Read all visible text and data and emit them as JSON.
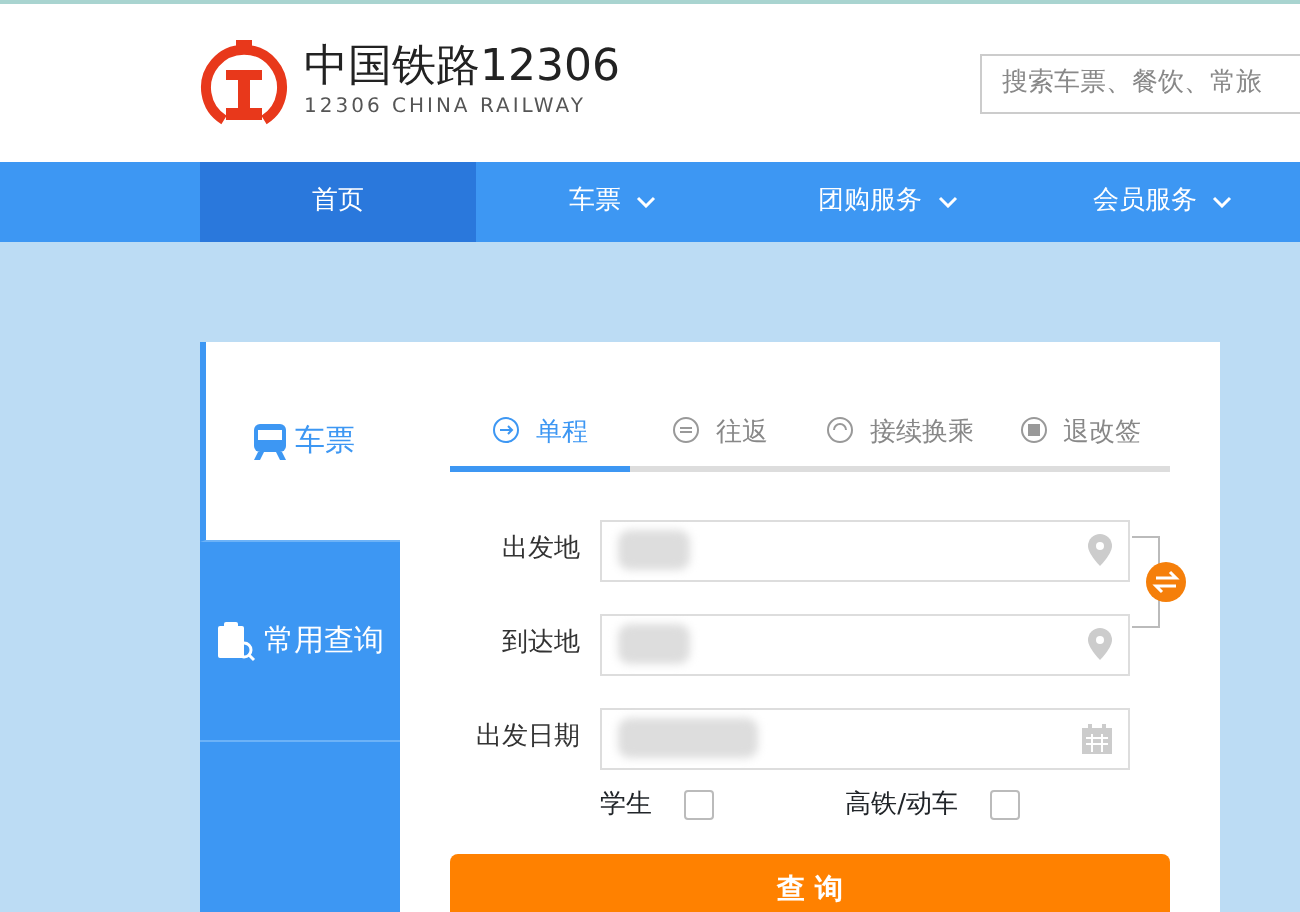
{
  "header": {
    "logo_title": "中国铁路12306",
    "logo_subtitle": "12306 CHINA RAILWAY",
    "search": {
      "placeholder": "搜索车票、餐饮、常旅"
    }
  },
  "nav": [
    {
      "label": "首页",
      "selected": true,
      "dropdown": false
    },
    {
      "label": "车票",
      "selected": false,
      "dropdown": true
    },
    {
      "label": "团购服务",
      "selected": false,
      "dropdown": true
    },
    {
      "label": "会员服务",
      "selected": false,
      "dropdown": true
    }
  ],
  "side_tabs": [
    {
      "kind": "train",
      "label": "车票",
      "selected": true
    },
    {
      "kind": "query",
      "label": "常用查询",
      "selected": false
    },
    {
      "kind": "meal",
      "selected": false
    }
  ],
  "trip_tabs": [
    {
      "kind": "oneway",
      "label": "单程",
      "selected": true
    },
    {
      "kind": "round",
      "label": "往返",
      "selected": false
    },
    {
      "kind": "transfer",
      "label": "接续换乘",
      "selected": false
    },
    {
      "kind": "refund",
      "label": "退改签",
      "selected": false
    }
  ],
  "fields": [
    {
      "kind": "place",
      "label": "出发地"
    },
    {
      "kind": "place",
      "label": "到达地"
    },
    {
      "kind": "date",
      "label": "出发日期"
    }
  ],
  "options": [
    {
      "label": "学生",
      "checked": false
    },
    {
      "label": "高铁/动车",
      "checked": false
    }
  ],
  "query_button": "查 询"
}
